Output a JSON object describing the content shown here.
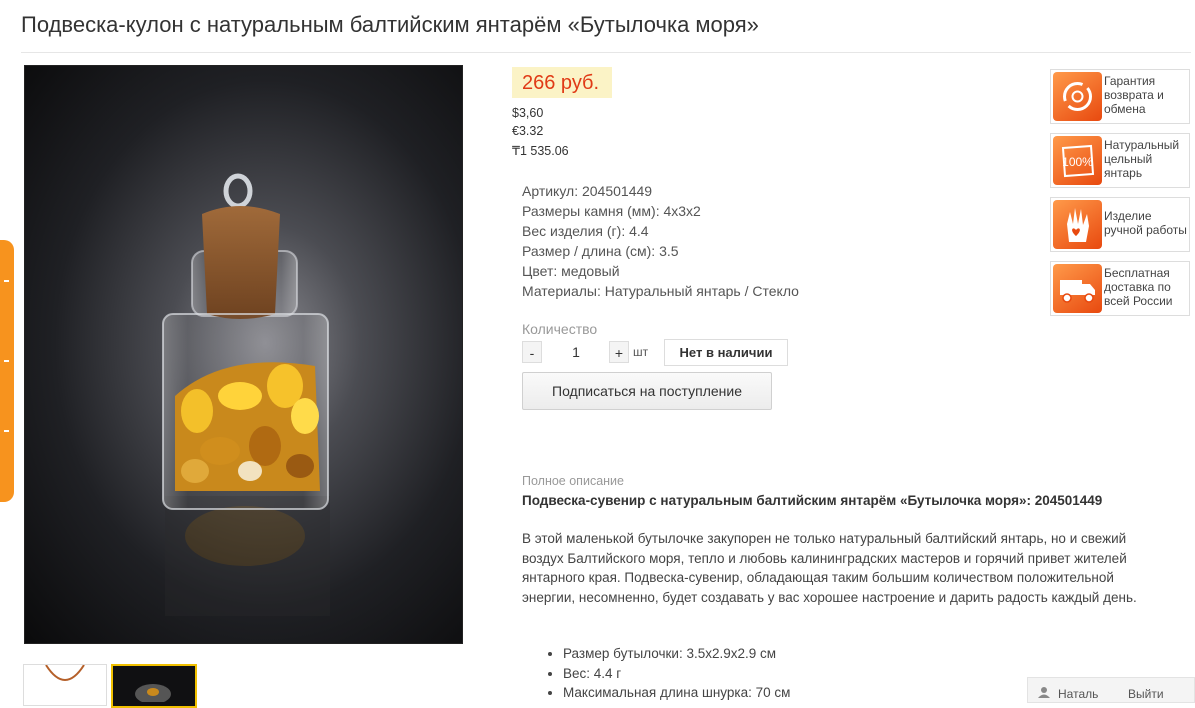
{
  "product": {
    "title": "Подвеска-кулон с натуральным балтийским янтарём «Бутылочка моря»"
  },
  "price": {
    "main": "266 руб.",
    "usd": "$3,60",
    "eur": "€3.32",
    "kzt": "₸1 535.06"
  },
  "specs": [
    {
      "label": "Артикул:",
      "value": "204501449"
    },
    {
      "label": "Размеры камня (мм):",
      "value": "4x3x2"
    },
    {
      "label": "Вес изделия (г):",
      "value": "4.4"
    },
    {
      "label": "Размер / длина (см):",
      "value": "3.5"
    },
    {
      "label": "Цвет:",
      "value": "медовый"
    },
    {
      "label": "Материалы:",
      "value": "Натуральный янтарь / Стекло"
    }
  ],
  "quantity": {
    "label": "Количество",
    "minus": "-",
    "value": "1",
    "plus": "+",
    "unit": "шт",
    "stock_button": "Нет в наличии",
    "subscribe_button": "Подписаться на поступление"
  },
  "description": {
    "label": "Полное описание",
    "heading": "Подвеска-сувенир с натуральным балтийским янтарём «Бутылочка моря»: 204501449",
    "text": "В этой маленькой бутылочке закупорен не только натуральный балтийский янтарь, но и свежий воздух Балтийского моря, тепло и любовь калининградских мастеров и горячий привет жителей янтарного края. Подвеска-сувенир, обладающая таким большим количеством положительной энергии, несомненно, будет создавать у вас хорошее настроение и дарить радость каждый день.",
    "features": [
      "Размер бутылочки: 3.5x2.9x2.9 см",
      "Вес: 4.4 г",
      "Максимальная длина шнурка: 70 см"
    ]
  },
  "badges": [
    {
      "icon": "return-exchange-icon",
      "lines": [
        "Гарантия",
        "возврата и",
        "обмена"
      ]
    },
    {
      "icon": "natural-amber-100-icon",
      "lines": [
        "Натуральный",
        "цельный",
        "янтарь"
      ]
    },
    {
      "icon": "handmade-hand-icon",
      "lines": [
        "Изделие",
        "ручной работы"
      ]
    },
    {
      "icon": "free-delivery-truck-icon",
      "lines": [
        "Бесплатная",
        "доставка по",
        "всей России"
      ]
    }
  ],
  "footer": {
    "user_name": "Наталь",
    "logout": "Выйти"
  },
  "colors": {
    "price": "#e03a16",
    "price_bg": "#fbf3c6",
    "accent_orange": "#f7931e",
    "badge_orange": "#e8490f"
  }
}
